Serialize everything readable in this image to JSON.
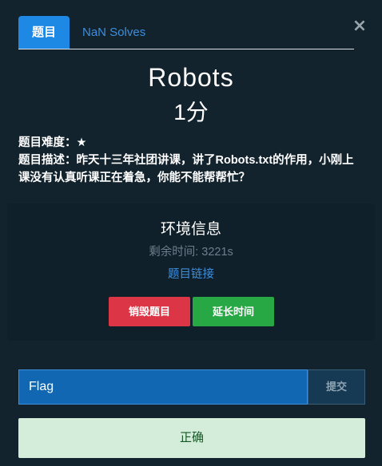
{
  "modal": {
    "close_glyph": "×",
    "tabs": [
      {
        "label": "题目"
      },
      {
        "label": "NaN Solves"
      }
    ]
  },
  "challenge": {
    "title": "Robots",
    "points": "1分",
    "difficulty_label": "题目难度：",
    "difficulty_value": "★",
    "description_label": "题目描述：",
    "description_text": "昨天十三年社团讲课，讲了Robots.txt的作用，小刚上课没有认真听课正在着急，你能不能帮帮忙？"
  },
  "environment": {
    "title": "环境信息",
    "remaining": "剩余时间: 3221s",
    "link_label": "题目链接",
    "destroy_label": "销毁题目",
    "extend_label": "延长时间"
  },
  "submission": {
    "placeholder": "Flag",
    "submit_label": "提交",
    "result": "正确"
  },
  "colors": {
    "background": "#12232d",
    "tab_active": "#1e88e5",
    "link": "#3d8edb",
    "danger": "#dc3545",
    "success": "#28a745",
    "input_bg": "#1167b1",
    "result_bg": "#d4edda",
    "result_text": "#155724"
  },
  "icons": {
    "close": "close-icon"
  }
}
